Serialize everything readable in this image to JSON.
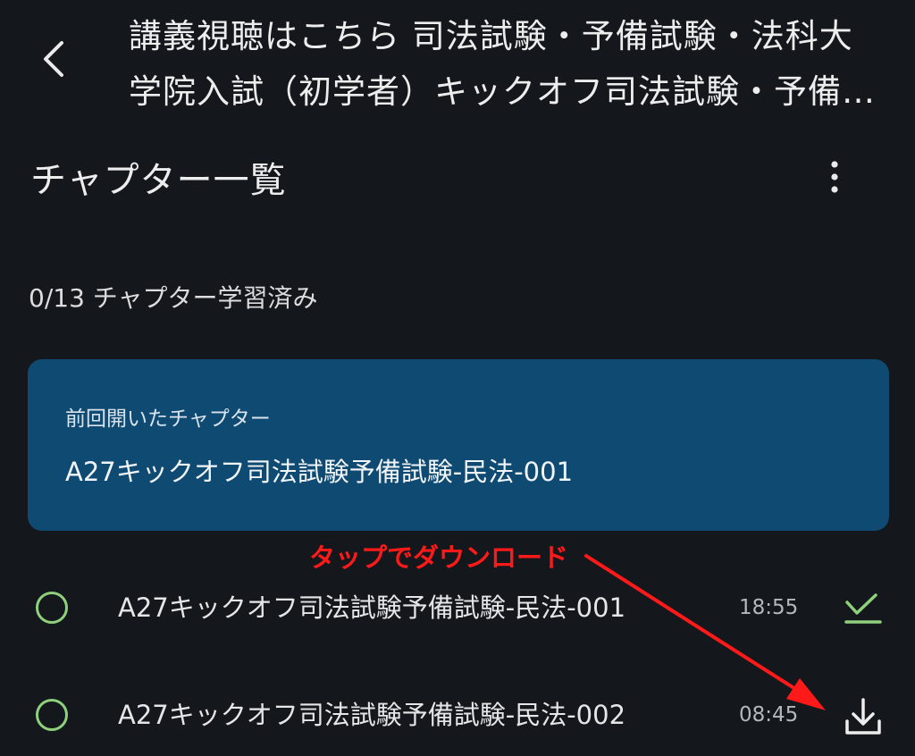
{
  "header": {
    "title": "講義視聴はこちら 司法試験・予備試験・法科大学院入試（初学者）キックオフ司法試験・予備試験・法科大学院入試",
    "back_icon": "chevron-left-icon"
  },
  "section": {
    "title": "チャプター一覧",
    "more_icon": "more-vertical-icon"
  },
  "progress": {
    "text": "0/13 チャプター学習済み",
    "completed": 0,
    "total": 13
  },
  "last_opened": {
    "label": "前回開いたチャプター",
    "title": "A27キックオフ司法試験予備試験-民法-001"
  },
  "annotation": {
    "text": "タップでダウンロード",
    "color": "#ff1a1a"
  },
  "chapters": [
    {
      "title": "A27キックオフ司法試験予備試験-民法-001",
      "duration": "18:55",
      "action_icon": "downloaded-check-icon"
    },
    {
      "title": "A27キックオフ司法試験予備試験-民法-002",
      "duration": "08:45",
      "action_icon": "download-icon"
    }
  ],
  "colors": {
    "background": "#14171b",
    "card": "#0f4a72",
    "accent_green": "#8fd07d",
    "annotation_red": "#ff1a1a"
  }
}
